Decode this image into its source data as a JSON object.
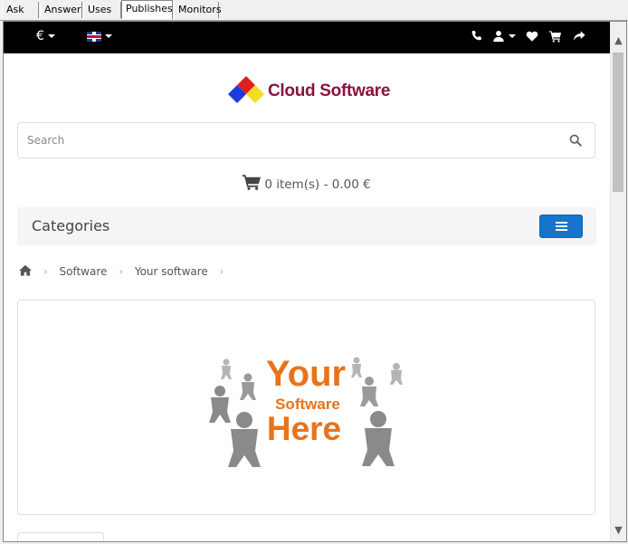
{
  "window_tabs": [
    "Ask",
    "Answer",
    "Uses",
    "Publishes",
    "Monitors"
  ],
  "active_tab": "Publishes",
  "topbar": {
    "currency": "€",
    "icons": [
      "phone-icon",
      "user-icon",
      "heart-icon",
      "shopping-cart-icon",
      "share-icon"
    ]
  },
  "logo": {
    "text": "Cloud Software"
  },
  "search": {
    "placeholder": "Search"
  },
  "cart": {
    "summary": "0 item(s) - 0.00 €"
  },
  "categories": {
    "label": "Categories"
  },
  "breadcrumb": {
    "items": [
      "Software",
      "Your software"
    ]
  },
  "product_image": {
    "line1": "Your",
    "line2": "Software",
    "line3": "Here"
  },
  "colors": {
    "topbar_bg": "#000000",
    "logo_text": "#8b1340",
    "menu_button": "#1674c9",
    "product_orange": "#e8731a"
  }
}
